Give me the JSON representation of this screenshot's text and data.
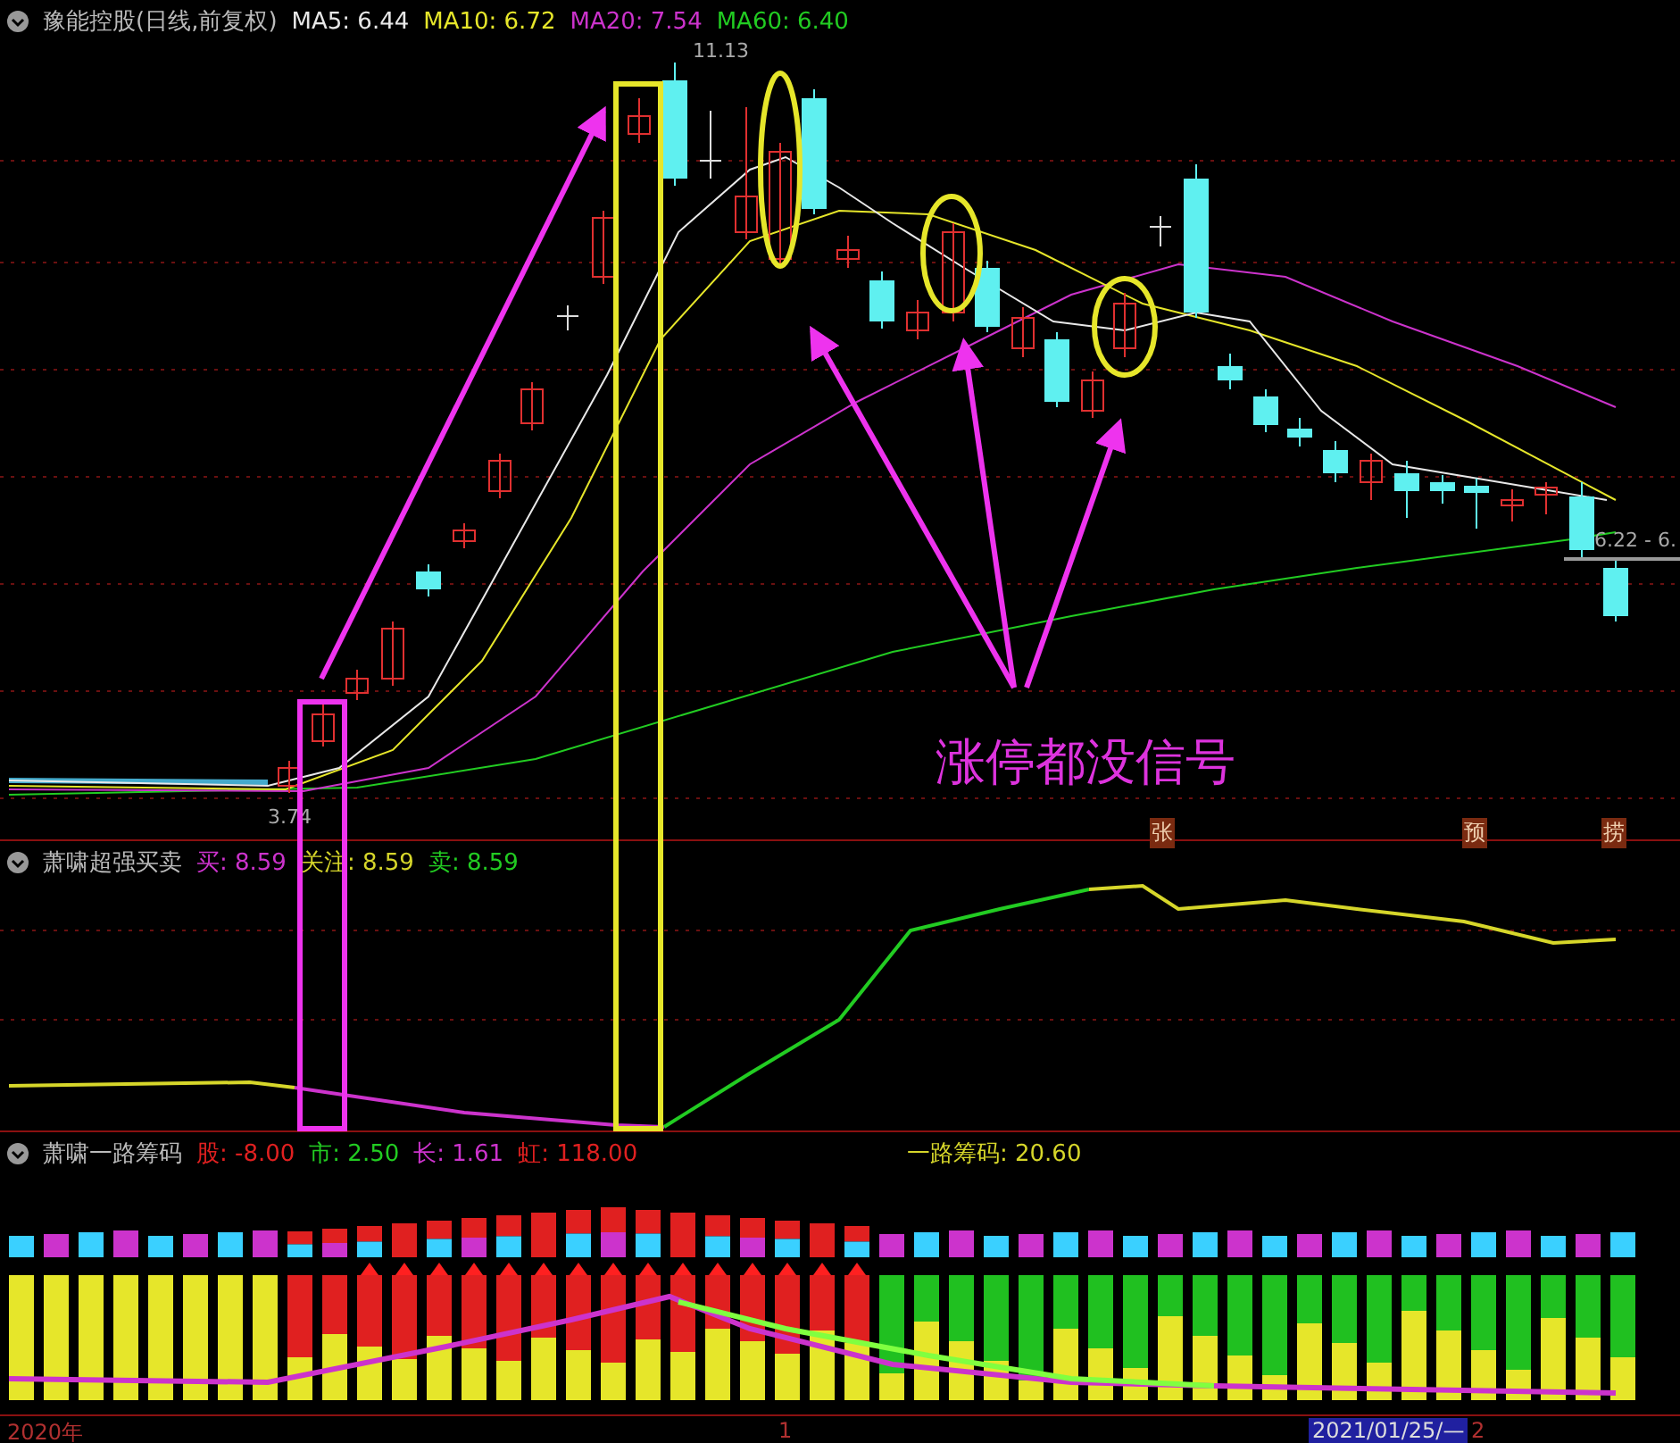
{
  "main_chart": {
    "title": "豫能控股(日线,前复权)",
    "indicators": [
      {
        "label": "MA5: 6.44",
        "color": "#e8e8e8"
      },
      {
        "label": "MA10: 6.72",
        "color": "#e6e62a"
      },
      {
        "label": "MA20: 7.54",
        "color": "#cc33cc"
      },
      {
        "label": "MA60: 6.40",
        "color": "#22cc22"
      }
    ],
    "high_label": "11.13",
    "low_label": "3.74",
    "last_price_label": "6.22 - 6.",
    "annotation": "涨停都没信号",
    "signals": [
      "张",
      "预",
      "捞"
    ]
  },
  "buy_sell_panel": {
    "title": "萧啸超强买卖",
    "indicators": [
      {
        "label": "买: 8.59",
        "color": "#cc33cc"
      },
      {
        "label": "关注: 8.59",
        "color": "#d6d62a"
      },
      {
        "label": "卖: 8.59",
        "color": "#22cc22"
      }
    ]
  },
  "chip_panel": {
    "title": "萧啸一路筹码",
    "indicators": [
      {
        "label": "股: -8.00",
        "color": "#e02020"
      },
      {
        "label": "市: 2.50",
        "color": "#22cc22"
      },
      {
        "label": "长: 1.61",
        "color": "#cc33cc"
      },
      {
        "label": "虹: 118.00",
        "color": "#e02020"
      }
    ],
    "summary": "一路筹码: 20.60"
  },
  "time_axis": {
    "labels": [
      "2020年",
      "1",
      "2021/01/25/—",
      "2"
    ]
  }
}
